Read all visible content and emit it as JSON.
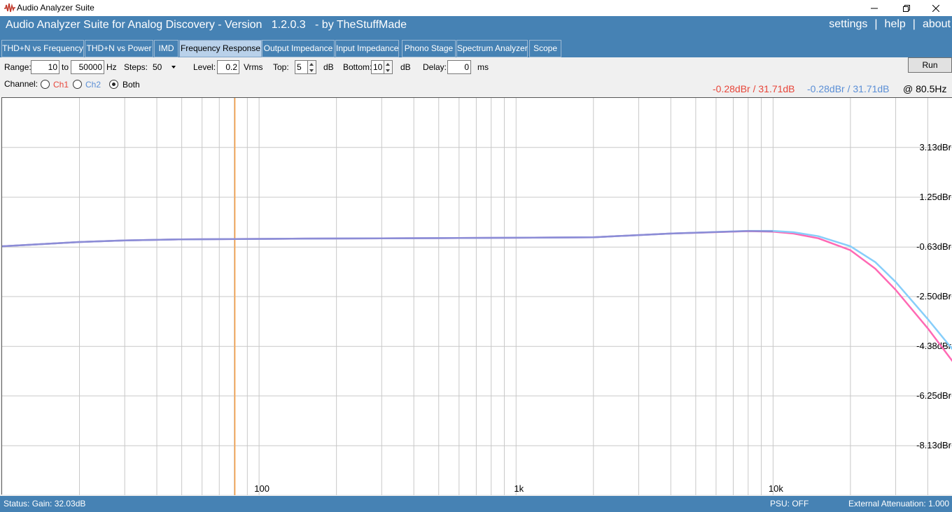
{
  "window": {
    "title": "Audio Analyzer Suite",
    "icon": "waveform-icon",
    "controls": [
      "minimize-icon",
      "restore-icon",
      "close-icon"
    ]
  },
  "header": {
    "title": "Audio Analyzer Suite for Analog Discovery - Version   1.2.0.3   - by TheStuffMade",
    "links": [
      "settings",
      "help",
      "about"
    ],
    "separator": "|",
    "background": "#4682b4"
  },
  "tabs": [
    {
      "label": "THD+N vs Frequency",
      "active": false
    },
    {
      "label": "THD+N vs Power",
      "active": false
    },
    {
      "label": "IMD",
      "active": false
    },
    {
      "label": "Frequency Response",
      "active": true
    },
    {
      "label": "Output Impedance",
      "active": false
    },
    {
      "label": "Input Impedance",
      "active": false
    },
    {
      "label": "Phono Stage",
      "active": false
    },
    {
      "label": "Spectrum Analyzer",
      "active": false
    },
    {
      "label": "Scope",
      "active": false
    }
  ],
  "controls": {
    "range_label": "Range:",
    "range_from": "10",
    "range_to_label": "to",
    "range_to": "50000",
    "range_unit": "Hz",
    "steps_label": "Steps:",
    "steps_value": "50",
    "level_label": "Level:",
    "level_value": "0.2",
    "level_unit": "Vrms",
    "top_label": "Top:",
    "top_value": "5",
    "top_unit": "dB",
    "bottom_label": "Bottom:",
    "bottom_value": "10",
    "bottom_unit": "dB",
    "delay_label": "Delay:",
    "delay_value": "0",
    "delay_unit": "ms",
    "run_label": "Run",
    "channel_label": "Channel:",
    "channels": [
      {
        "label": "Ch1",
        "checked": false,
        "color": "#e8463a"
      },
      {
        "label": "Ch2",
        "checked": false,
        "color": "#5b8fd6"
      },
      {
        "label": "Both",
        "checked": true,
        "color": "#000000"
      }
    ]
  },
  "readouts": {
    "ch1": "-0.28dBr / 31.71dB",
    "ch2": "-0.28dBr / 31.71dB",
    "cursor": "@ 80.5Hz",
    "ch1_color": "#e8463a",
    "ch2_color": "#5b8fd6"
  },
  "chart_data": {
    "type": "line",
    "x_scale": "log",
    "xlim": [
      10,
      50000
    ],
    "ylim": [
      -10,
      5
    ],
    "x_tick_labels": [
      {
        "value": 100,
        "label": "100"
      },
      {
        "value": 1000,
        "label": "1k"
      },
      {
        "value": 10000,
        "label": "10k"
      }
    ],
    "y_tick_labels": [
      {
        "value": 3.13,
        "label": "3.13dBr"
      },
      {
        "value": 1.25,
        "label": "1.25dBr"
      },
      {
        "value": -0.63,
        "label": "-0.63dBr"
      },
      {
        "value": -2.5,
        "label": "-2.50dBr"
      },
      {
        "value": -4.38,
        "label": "-4.38dBr"
      },
      {
        "value": -6.25,
        "label": "-6.25dBr"
      },
      {
        "value": -8.13,
        "label": "-8.13dBr"
      }
    ],
    "grid": true,
    "cursor_x": 80.5,
    "cursor_color": "#ffa040",
    "series": [
      {
        "color": "#ff69b4",
        "x": [
          10,
          20,
          30,
          50,
          80.5,
          150,
          300,
          600,
          1000,
          2000,
          4000,
          8000,
          10000,
          12000,
          15000,
          20000,
          25000,
          30000,
          40000,
          50000
        ],
        "y": [
          -0.6,
          -0.44,
          -0.38,
          -0.34,
          -0.33,
          -0.31,
          -0.3,
          -0.29,
          -0.28,
          -0.26,
          -0.12,
          -0.03,
          -0.05,
          -0.12,
          -0.3,
          -0.75,
          -1.45,
          -2.25,
          -3.7,
          -4.95
        ]
      },
      {
        "color": "#87cefa",
        "x": [
          10,
          20,
          30,
          50,
          80.5,
          150,
          300,
          600,
          1000,
          2000,
          4000,
          8000,
          10000,
          12000,
          15000,
          20000,
          25000,
          30000,
          40000,
          50000
        ],
        "y": [
          -0.6,
          -0.44,
          -0.38,
          -0.34,
          -0.33,
          -0.31,
          -0.3,
          -0.29,
          -0.28,
          -0.26,
          -0.12,
          -0.02,
          -0.02,
          -0.07,
          -0.22,
          -0.6,
          -1.2,
          -1.95,
          -3.35,
          -4.5
        ]
      }
    ]
  },
  "status": {
    "left": "Status: Gain: 32.03dB",
    "psu": "PSU: OFF",
    "attenuation": "External Attenuation: 1.000"
  }
}
